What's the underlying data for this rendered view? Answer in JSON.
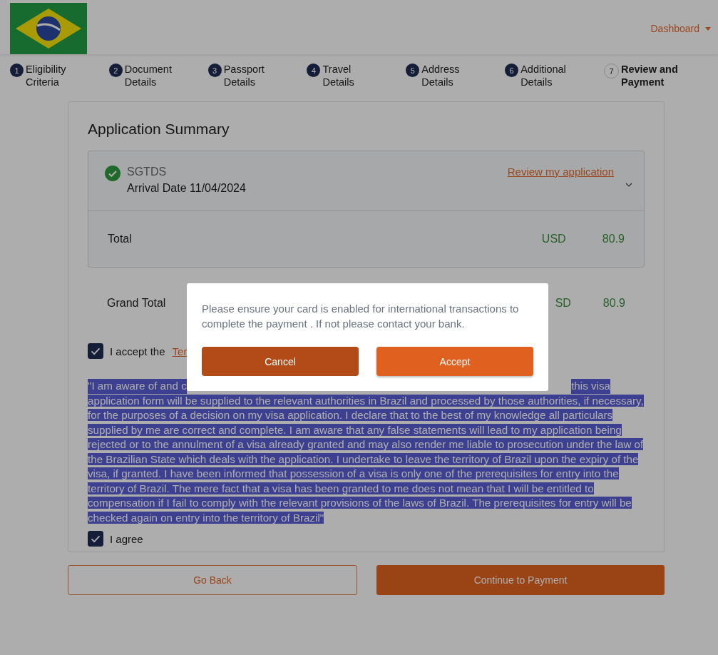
{
  "header": {
    "menu": {
      "label": "Dashboard"
    }
  },
  "steps": [
    {
      "number": "1",
      "label": "Eligibility Criteria",
      "selected": false
    },
    {
      "number": "2",
      "label": "Document Details",
      "selected": false
    },
    {
      "number": "3",
      "label": "Passport Details",
      "selected": false
    },
    {
      "number": "4",
      "label": "Travel Details",
      "selected": false
    },
    {
      "number": "5",
      "label": "Address Details",
      "selected": false
    },
    {
      "number": "6",
      "label": "Additional Details",
      "selected": false
    },
    {
      "number": "7",
      "label": "Review and Payment",
      "selected": true
    }
  ],
  "summary": {
    "title": "Application Summary",
    "application": {
      "name": "SGTDS",
      "arrival": "Arrival Date 11/04/2024",
      "review_link": "Review my application",
      "expanded": false
    },
    "total": {
      "label": "Total",
      "currency": "USD",
      "amount": "80.9"
    },
    "grand_total": {
      "label": "Grand Total",
      "currency": "SD",
      "amount": "80.9"
    }
  },
  "terms": {
    "checked": true,
    "label": "I accept the",
    "link": "Ter"
  },
  "declaration": {
    "line1_start": "\"I am aware of and c",
    "line1_end": "this visa",
    "rest": "application form will be supplied to the relevant authorities in Brazil and processed by those authorities, if necessary, for the purposes of a decision on my visa application. I declare that to the best of my knowledge all particulars supplied by me are correct and complete. I am aware that any false statements will lead to my application being rejected or to the annulment of a visa already granted and may also render me liable to prosecution under the law of the Brazilian State which deals with the application. I undertake to leave the territory of Brazil upon the expiry of the visa, if granted. I have been informed that possession of a visa is only one of the prerequisites for entry into the territory of Brazil. The mere fact that a visa has been granted to me does not mean that I will be entitled to compensation if I fail to comply with the relevant provisions of the laws of Brazil. The prerequisites for entry will be checked again on entry into the territory of Brazil\""
  },
  "agree": {
    "checked": true,
    "label": "I agree"
  },
  "buttons": [
    {
      "label": "Go Back",
      "kind": "outline"
    },
    {
      "label": "Continue to Payment",
      "kind": "solid"
    }
  ],
  "dialog": {
    "message": "Please ensure your card is enabled for international transactions to complete the payment . If not please contact your bank.",
    "buttons": [
      {
        "label": "Cancel",
        "kind": "secondary"
      },
      {
        "label": "Accept",
        "kind": "primary"
      }
    ]
  }
}
